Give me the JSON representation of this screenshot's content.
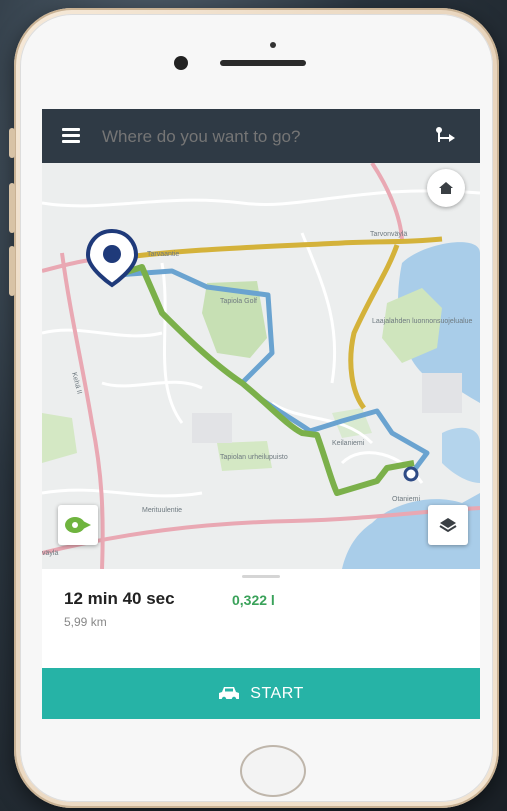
{
  "header": {
    "search_placeholder": "Where do you want to go?"
  },
  "map": {
    "labels": {
      "road_top": "Tarvaantie",
      "road_top_right": "Tarvonväylä",
      "road_bottom": "Merituulentie",
      "road_bottom_left": "väylä",
      "road_left": "Kehä II",
      "park_1": "Tapiola Golf",
      "park_2": "Laajalahden luonnonsuojelualue",
      "park_3": "Tapiolan urheilupuisto",
      "district_1": "Otaniemi",
      "district_2": "Keilaniemi"
    }
  },
  "route": {
    "duration": "12 min 40 sec",
    "fuel": "0,322 l",
    "distance": "5,99 km"
  },
  "start_label": "START",
  "colors": {
    "topbar": "#2f3a45",
    "start": "#26b3a6",
    "route_green": "#7bb04a",
    "route_blue": "#6aa3d0",
    "route_yellow": "#d4b23a",
    "pin": "#1f3a7a"
  },
  "icons": [
    "menu-icon",
    "route-options-icon",
    "home-icon",
    "layers-icon",
    "eco-marker-icon",
    "car-icon",
    "location-pin-icon"
  ]
}
